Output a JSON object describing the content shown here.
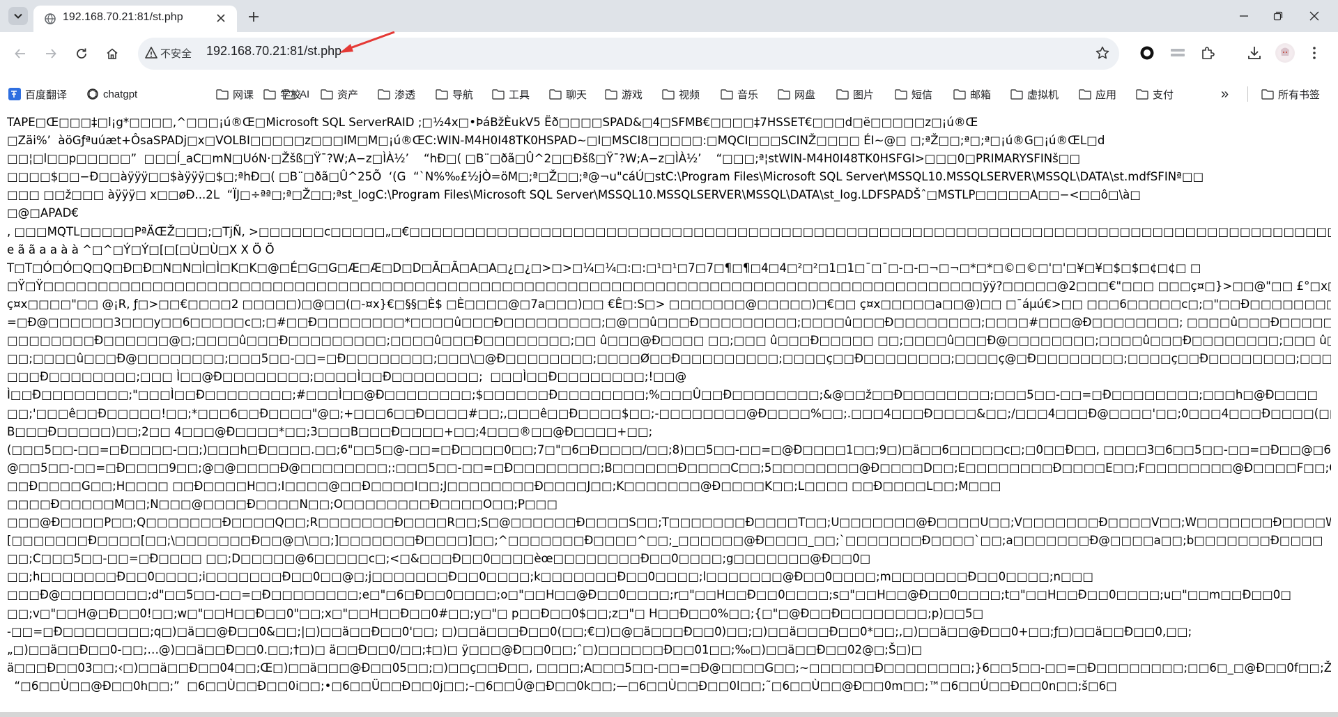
{
  "tab": {
    "title": "192.168.70.21:81/st.php",
    "favicon": "globe-icon"
  },
  "address_bar": {
    "security_label": "不安全",
    "url": "192.168.70.21:81/st.php"
  },
  "bookmarks": {
    "items": [
      {
        "label": "百度翻译",
        "icon": "baidu-translate-icon"
      },
      {
        "label": "chatgpt",
        "icon": "chatgpt-icon"
      },
      {
        "label": "网课",
        "icon": "folder-icon"
      },
      {
        "label": "学校",
        "icon": "folder-icon"
      },
      {
        "label": "AI",
        "icon": "folder-icon"
      },
      {
        "label": "资产",
        "icon": "folder-icon"
      },
      {
        "label": "渗透",
        "icon": "folder-icon"
      },
      {
        "label": "导航",
        "icon": "folder-icon"
      },
      {
        "label": "工具",
        "icon": "folder-icon"
      },
      {
        "label": "聊天",
        "icon": "folder-icon"
      },
      {
        "label": "游戏",
        "icon": "folder-icon"
      },
      {
        "label": "视频",
        "icon": "folder-icon"
      },
      {
        "label": "音乐",
        "icon": "folder-icon"
      },
      {
        "label": "网盘",
        "icon": "folder-icon"
      },
      {
        "label": "图片",
        "icon": "folder-icon"
      },
      {
        "label": "短信",
        "icon": "folder-icon"
      },
      {
        "label": "邮箱",
        "icon": "folder-icon"
      },
      {
        "label": "虚拟机",
        "icon": "folder-icon"
      },
      {
        "label": "应用",
        "icon": "folder-icon"
      },
      {
        "label": "支付",
        "icon": "folder-icon"
      }
    ],
    "all_bookmarks": "所有书签",
    "overflow": "»"
  },
  "colors": {
    "tabstrip": "#dfe3e8",
    "omnibox": "#eef1f5",
    "annotation_arrow": "#e53935"
  },
  "page": {
    "lines": [
      "TAPE□Œ□□□‡□l¡g*□□□□,^□□□¡ú®Œ□Microsoft SQL ServerRAID ;□½4x□•ÞáBžÈukV5 Ëð□□□□SPAD&□4□SFMB€□□□□‡7HSSET€□□□d□ë□□□□□z□¡ú®Œ",
      "□Zäi%’  àöGƒªuúæt+ÔsaSPADj□x□VOLBI□□□□□z□□□IM□M□¡ú®ŒC:WIN-M4H0I48TK0HSPAD~□I□MSCI8□□□□□:□MQCI□□□SCINŽ□□□□ ÉI~@□ □;ªŽ□□;ª□;ª□¡ú®G□¡ú®ŒL□d",
      "□□¦□l□□p□□□□□”  □□□Í_aC□mN□UóN·□Žšß□Ÿ¯?W;A−z□ÌÀ½’    “hÐ□( □B¨□ðã□Û^2□□Ðšß□Ÿ¯?W;A−z□ÌÀ½’    “□□□;ª¦stWIN-M4H0I48TK0HSFGI>□□□0□PRIMARYSFINš□□",
      "□□□□$□□−Ð□□àÿÿÿ□□$àÿÿÿ□$□;ªhÐ□( □B¨□ðã□Û^25Õ  ‘(G  “`N%‰£½jÒ=öM□;ª□Ž□□;ª@¬u\"cáÚ□stC:\\Program Files\\Microsoft SQL Server\\MSSQL10.MSSQLSERVER\\MSSQL\\DATA\\st.mdfSFINª□□",
      "□□□ □□ž□□□ àÿÿÿ□ x□□øÐ...2L  “ÏJ□÷ªª□;ª□Ž□□;ªst_logC:\\Program Files\\Microsoft SQL Server\\MSSQL10.MSSQLSERVER\\MSSQL\\DATA\\st_log.LDFSPADŠˆ□MSTLP□□□□□A□□−<□□ô□\\à□",
      "□@□APAD€",
      ", □□□MQTL□□□□□PªÄŒŽ□□□;□TjÑ, >□□□□□□c□□□□□„□€□□□□□□□□□□□□□□□□□□□□□□□□□□□□□□□□□□□□□□□□□□□□□□□□□□□□□□□□□□□□□□□□□□□□□□□□□□□□□□□□□□□□□□□□□□□□□□□□□□□□□□□□□□□□□□□",
      "e ã ã a a à à ^□^□Ý□Ý□[□[□Ù□Ù□X X Ö Ö",
      "T□T□Ó□Ó□Q□Q□Ð□Ð□N□N□Ì□Ì□K□K□@□É□G□G□Æ□Æ□D□D□Ã□Ã□A□A□¿□¿□>□>□¼□¼□:□:□¹□¹□7□7□¶□¶□4□4□²□²□1□1□¯□¯□-□-□¬□¬□*□*□©□©□'□'□¥□¥□$□$□¢□¢□ □",
      "□Ÿ□Ÿ□□□□□□□□□□□□□□□□□□□□□□□□□□□□□□□□□□□□□□□□□□□□□□□□□□□□□□□□□□□□□□□□□□□□□□□□□□□□□□□□□□□□□□ÿÿ?□□□□□@2□□□€\"□□□ □□□ç¤□}>□□@\"□□ £°□x□€>□□ □□□□5□@□□\"□□□□€□□□□",
      "ç¤x□□□□\"□□ @¡R, ƒ□>□□€□□□□2 □□□□□)□@□□(□-¤x}€□§§□È$ □È□□□□@□7a□□□)□□ €Ê□:S□> □□□□□□□@□□□□□)□€□□ ç¤x□□□□□a□□@)□□ □¯áµú€>□□ □□□6□□□□□c□;□\"□□Ð□□□□□□□□ □□5□ -□",
      "=□Ð@□□□□□□3□□□y□□6□□□□□c□;□#□□Ð□□□□□□□□*□□□□û□□□Ð□□□□□□□□□;□@□□û□□□Ð□□□□□□□□□;□□□□û□□□Ð□□□□□□□□;□□□□#□□□@Ð□□□□□□□□; □□□□û□□□Ð□□□□□□□□;",
      "□□□□□□□□Ð□□□□□□@□;□□□□û□□□Ð□□□□□□□□□;□□□□û□□□Ð□□□□□□□□;□□ û□□□@Ð□□□□ □□;□□□ û□□□Ð□□□□□ □□;□□□□û□□□Ð@□□□□□□□□;□□□□û□□□Ð□□□□□□□□;□□□ û□□□Ð□□□□",
      "□□;□□□□û□□□Ð@□□□□□□□□;□□□5□□-□□=□Ð□□□□□□□□;□□□\\□@Ð□□□□□□□□;□□□□Ø□□Ð□□□□□□□□□;□□□□ç□□Ð□□□□□□□□;□□□□ç@□Ð□□□□□□□□;□□□□ç□□Ð□□□□□□□□;□□□□ç□□@Ð□□□□□□□□;□□□□",
      "□□□Ð□□□□□□□□;□□□ Ì□□@Ð□□□□□□□□;□□□□Ì□□Ð□□□□□□□□;  □□□Ì□□Ð□□□□□□□□;!□□@",
      "Ì□□Ð□□□□□□□□;\"□□□Ì□□Ð□□□□□□□□;#□□□Ì□□@Ð□□□□□□□□;$□□□□□□Ð□□□□□□□□;%□□□Û□□Ð□□□□□□□□;&@□□ž□□Ð□□□□□□□□;□□□5□□-□□=□Ð□□□□□□□□;□□□h□@Ð□□□□",
      "□□;'□□□ê□□Ð□□□□□!□□;*□□□6□□Ð□□□□\"@□;+□□□6□□Ð□□□□#□□;,□□□ê□□Ð□□□□$□□;-□□□□□□□□@Ð□□□□%□□;.□□□4□□□Ð□□□□&□□;/□□□4□□□Ð@□□□□'□□;0□□□4□□□Ð□□□□(□□;1□□",
      "B□□□Ð□□□□□)□□;2□□ 4□□□@Ð□□□□*□□;3□□□B□□□Ð□□□□+□□;4□□□®□□@Ð□□□□+□□;",
      "(□□□5□□-□□=□Ð□□□□-□□;)□□□h□Ð□□□□.□□;6\"□□5□@-□□=□Ð□□□□0□□;7□\"□6□Ð□□□□/□□;8)□□5□□-□□=□@Ð□□□□1□□;9□)□ä□□6□□□□□c□;□0□□Ð□□, □□□□3□6□□5□□-□□=□Ð□□@□6□□;;□6□",
      "@□□5□□-□□=□Ð□□□□9□□;@□@□□□□Ð@□□□□□□□□;:□□□5□□-□□=□Ð□□□□□□□□;B□□□□□□Ð□□□□C□□;5□□□□□□□□@Ð□□□□D□□;E□□□□□□□□Ð□□□□E□□;F□□□□□□□□@Ð□□□□F□□;G□□□□",
      "□□Ð□□□□G□□;H□□□□ □□Ð□□□□H□□;I□□□□@□□Ð□□□□I□□;J□□□□□□□□Ð□□□□J□□;K□□□□□□□@Ð□□□□K□□;L□□□□ □□Ð□□□□L□□;M□□□",
      "□□□□Ð□□□□□M□□;N□□□@□□□□Ð□□□□N□□;O□□□□□□□□Ð□□□□O□□;P□□□",
      "□□□@Ð□□□□P□□;Q□□□□□□□Ð□□□□Q□□;R□□□□□□□Ð□□□□R□□;S□@□□□□□□Ð□□□□S□□;T□□□□□□□Ð□□□□T□□;U□□□□□□□@Ð□□□□U□□;V□□□□□□□Ð□□□□V□□;W□□□□□□□Ð□□□□W□□@X□□",
      "[□□□□□□□Ð□□□□[□□;\\□□□□□□□Ð□□@□\\□□;]□□□□□□□Ð□□□□]□□;^□□□□□□□Ð□□□□^□□;_□□□□□□@Ð□□□□_□□;`□□□□□□□Ð□□□□`□□;a□□□□□□□Ð@□□□□a□□;b□□□□□□□Ð□□□□",
      "□□;C□□□5□□-□□=□Ð□□□□ □□;D□□□□□@6□□□□□c□;<□&□□□Ð□□0□□□□èœ□□□□□□□□Ð□□0□□□□;g□□□□□□□@Ð□□0□",
      "□□;h□□□□□□□Ð□□0□□□□;i□□□□□□□Ð□□0□□@□;j□□□□□□□Ð□□0□□□□;k□□□□□□□Ð□□0□□□□;l□□□□□□□@Ð□□0□□□□;m□□□□□□□Ð□□0□□□□;n□□□",
      "□□□Ð@□□□□□□□□;d\"□□5□□-□□=□Ð□□□□□□□□;e□\"□6□Ð□□0□□□□;o□\"□□H□□@Ð□□0□□□□;r□\"□□H□□Ð□□0□□□□;s□\"□□H□□@Ð□□0□□□□;t□\"□□H□□Ð□□0□□□□;u□\"□□m□□Ð□□0□",
      "□□;v□\"□□H@□Ð□□0!□□;w□\"□□H□□Ð□□0\"□□;x□\"□□H□□Ð□□0#□□;y□\"□ p□□Ð□□0$□□;z□\"□ H□□Ð□□0%□□;{□\"□@Ð□□Ð□□□□□□□□;p)□□5□",
      "-□□=□Ð□□□□□□□□;q□)□ä□□@Ð□□0&□□;|□)□□ä□□Ð□□0'□□; □)□□ä□□□Ð□□0(□□;€□)□@□ä□□□Ð□□0)□□;□)□□ä□□□Ð□□0*□□;‚□)□□ä□□@Ð□□0+□□;ƒ□)□□ä□□Ð□□0,□□;",
      "„□)□□ä□□Ð□□0-□□;…@)□□ä□□Ð□□0.□□;†□)□ ä□□Ð□□0/□□;‡□)□ ÿ□□□@Ð□□0□□;ˆ□)□□□□□□Ð□□01□□;‰□)□□ä□□Ð□□02@□;Š□)□",
      "ä□□□Ð□□03□□;‹□)□□ä□□Ð□□04□□;Œ□)□□ä□□□@Ð□□05□□;□)□□ç□□Ð□□, □□□□;A□□□5□□-□□=□Ð@□□□□G□□;~□□□□□□Ð□□□□□□□□;}6□□5□□-□□=□Ð□□□□□□□□;□□6□_□@Ð□□0f□□;Ž□6□",
      "  “□6□□Ù□□@Ð□□0h□□;”  □6□□Ù□□Ð□□0i□□;•□6□□Ü□□Ð□□0j□□;–□6□□Û@□Ð□□0k□□;—□6□□Ù□□Ð□□0l□□;˜□6□□Ù□□@Ð□□0m□□;™□6□□Ú□□Ð□□0n□□;š□6□"
    ]
  }
}
